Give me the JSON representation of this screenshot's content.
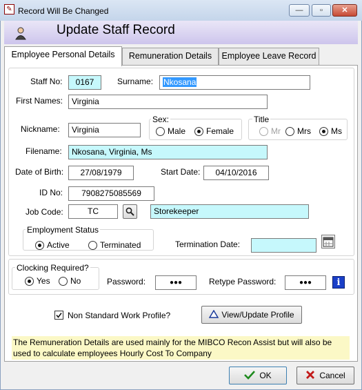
{
  "window": {
    "title": "Record Will Be Changed",
    "minimize": "▭",
    "maximize": "▢",
    "close": "✕"
  },
  "header": {
    "title": "Update Staff Record"
  },
  "tabs": [
    "Employee Personal Details",
    "Remuneration Details",
    "Employee Leave Record"
  ],
  "form": {
    "staff_no_label": "Staff No:",
    "staff_no": "0167",
    "surname_label": "Surname:",
    "surname": "Nkosana",
    "first_names_label": "First Names:",
    "first_names": "Virginia",
    "nickname_label": "Nickname:",
    "nickname": "Virginia",
    "sex": {
      "label": "Sex:",
      "options": [
        "Male",
        "Female"
      ],
      "selected": "Female"
    },
    "title": {
      "label": "Title",
      "options": [
        "Mr",
        "Mrs",
        "Ms"
      ],
      "selected": "Ms"
    },
    "filename_label": "Filename:",
    "filename": "Nkosana, Virginia, Ms",
    "dob_label": "Date of Birth:",
    "dob": "27/08/1979",
    "start_date_label": "Start Date:",
    "start_date": "04/10/2016",
    "id_no_label": "ID No:",
    "id_no": "7908275085569",
    "job_code_label": "Job Code:",
    "job_code": "TC",
    "job_desc": "Storekeeper",
    "employment_status": {
      "label": "Employment Status",
      "options": [
        "Active",
        "Terminated"
      ],
      "selected": "Active"
    },
    "termination_label": "Termination Date:",
    "termination_date": "",
    "clocking": {
      "label": "Clocking Required?",
      "options": [
        "Yes",
        "No"
      ],
      "selected": "Yes"
    },
    "password_label": "Password:",
    "password": "●●●",
    "retype_label": "Retype Password:",
    "retype": "●●●",
    "info_icon": "i",
    "non_standard_label": "Non Standard Work Profile?",
    "non_standard_checked": true,
    "view_profile_label": "View/Update Profile"
  },
  "note": "The Remuneration Details are used mainly for the MIBCO Recon Assist but will also be used to calculate employees Hourly Cost To Company",
  "buttons": {
    "ok": "OK",
    "cancel": "Cancel"
  },
  "colors": {
    "field_cyan": "#c6f8fc",
    "header": "#cdc5ec",
    "note": "#fbf8c6",
    "selection": "#3399ff"
  }
}
